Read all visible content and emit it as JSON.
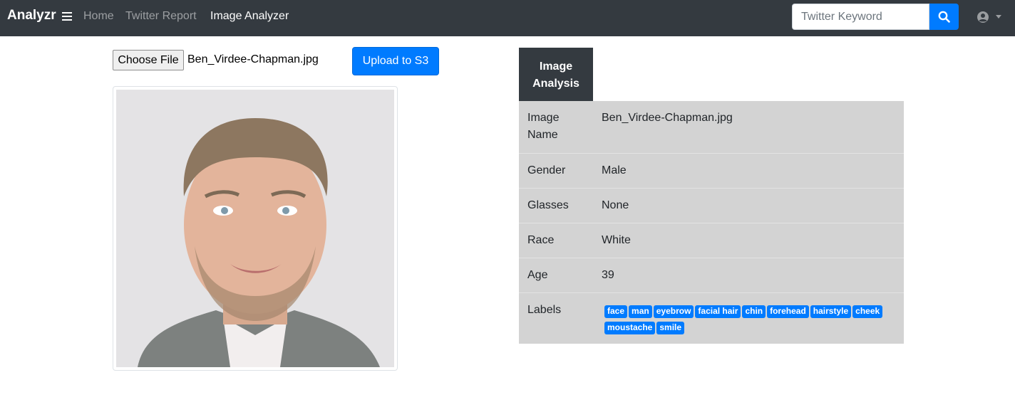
{
  "navbar": {
    "brand": "Analyzr",
    "links": [
      "Home",
      "Twitter Report",
      "Image Analyzer"
    ],
    "search_placeholder": "Twitter Keyword"
  },
  "upload": {
    "choose_label": "Choose File",
    "file_name": "Ben_Virdee-Chapman.jpg",
    "upload_label": "Upload to S3"
  },
  "analysis": {
    "tab_label": "Image Analysis",
    "rows": [
      {
        "label": "Image Name",
        "value": "Ben_Virdee-Chapman.jpg"
      },
      {
        "label": "Gender",
        "value": "Male"
      },
      {
        "label": "Glasses",
        "value": "None"
      },
      {
        "label": "Race",
        "value": "White"
      },
      {
        "label": "Age",
        "value": "39"
      },
      {
        "label": "Labels",
        "value": ""
      }
    ],
    "labels": [
      "face",
      "man",
      "eyebrow",
      "facial hair",
      "chin",
      "forehead",
      "hairstyle",
      "cheek",
      "moustache",
      "smile"
    ]
  },
  "colors": {
    "navbar_bg": "#343a40",
    "accent": "#007bff",
    "table_bg": "#d3d3d3"
  },
  "icons": [
    "menu-icon",
    "search-icon",
    "user-circle-icon",
    "chevron-down-icon"
  ]
}
